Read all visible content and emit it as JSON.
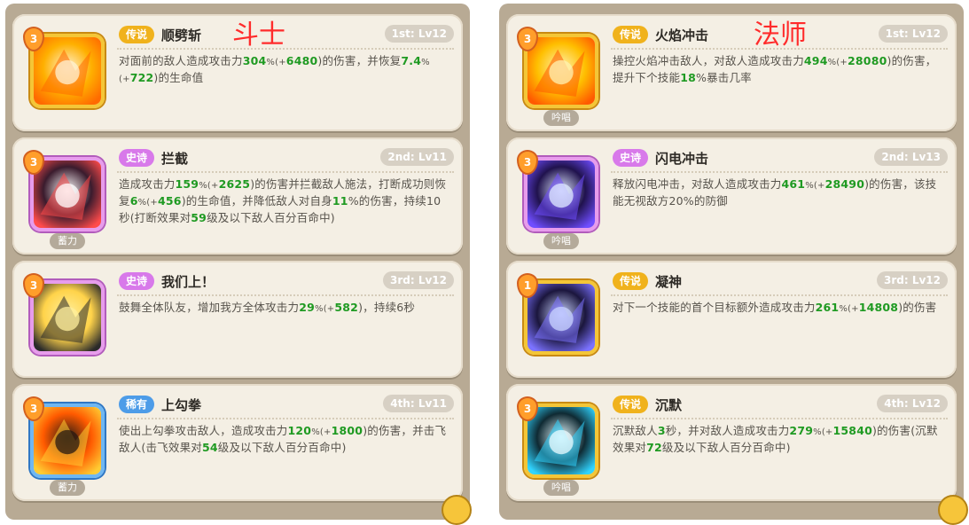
{
  "left": {
    "class_label": "斗士",
    "skills": [
      {
        "rarity": "传说",
        "name": "顺劈斩",
        "level": "1st: Lv12",
        "gem": "3",
        "tag": "",
        "desc_parts": [
          [
            "对面前的敌人造成攻击力",
            ""
          ],
          [
            "304",
            "g"
          ],
          [
            "%(+",
            "s"
          ],
          [
            "6480",
            "g"
          ],
          [
            ")的伤害，并恢复",
            ""
          ],
          [
            "7.4",
            "g"
          ],
          [
            "%(+",
            "s"
          ],
          [
            "722",
            "g"
          ],
          [
            ")的生命值",
            ""
          ]
        ]
      },
      {
        "rarity": "史诗",
        "name": "拦截",
        "level": "2nd: Lv11",
        "gem": "3",
        "tag": "蓄力",
        "desc_parts": [
          [
            "造成攻击力",
            ""
          ],
          [
            "159",
            "g"
          ],
          [
            "%(+",
            "s"
          ],
          [
            "2625",
            "g"
          ],
          [
            ")的伤害并拦截敌人施法，打断成功则恢复",
            ""
          ],
          [
            "6",
            "g"
          ],
          [
            "%(+",
            "s"
          ],
          [
            "456",
            "g"
          ],
          [
            ")的生命值，并降低敌人对自身",
            ""
          ],
          [
            "11",
            "g"
          ],
          [
            "%的伤害，持续10秒(打断效果对",
            ""
          ],
          [
            "59",
            "g"
          ],
          [
            "级及以下敌人百分百命中)",
            ""
          ]
        ]
      },
      {
        "rarity": "史诗",
        "name": "我们上！",
        "level": "3rd: Lv12",
        "gem": "3",
        "tag": "",
        "desc_parts": [
          [
            "鼓舞全体队友，增加我方全体攻击力",
            ""
          ],
          [
            "29",
            "g"
          ],
          [
            "%(+",
            "s"
          ],
          [
            "582",
            "g"
          ],
          [
            ")，持续6秒",
            ""
          ]
        ]
      },
      {
        "rarity": "稀有",
        "name": "上勾拳",
        "level": "4th: Lv11",
        "gem": "3",
        "tag": "蓄力",
        "desc_parts": [
          [
            "使出上勾拳攻击敌人，造成攻击力",
            ""
          ],
          [
            "120",
            "g"
          ],
          [
            "%(+",
            "s"
          ],
          [
            "1800",
            "g"
          ],
          [
            ")的伤害，并击飞敌人(击飞效果对",
            ""
          ],
          [
            "54",
            "g"
          ],
          [
            "级及以下敌人百分百命中)",
            ""
          ]
        ]
      }
    ]
  },
  "right": {
    "class_label": "法师",
    "skills": [
      {
        "rarity": "传说",
        "name": "火焰冲击",
        "level": "1st: Lv12",
        "gem": "3",
        "tag": "吟唱",
        "desc_parts": [
          [
            "操控火焰冲击敌人，对敌人造成攻击力",
            ""
          ],
          [
            "494",
            "g"
          ],
          [
            "%(+",
            "s"
          ],
          [
            "28080",
            "g"
          ],
          [
            ")的伤害，提升下个技能",
            ""
          ],
          [
            "18",
            "g"
          ],
          [
            "%暴击几率",
            ""
          ]
        ]
      },
      {
        "rarity": "史诗",
        "name": "闪电冲击",
        "level": "2nd: Lv13",
        "gem": "3",
        "tag": "吟唱",
        "desc_parts": [
          [
            "释放闪电冲击，对敌人造成攻击力",
            ""
          ],
          [
            "461",
            "g"
          ],
          [
            "%(+",
            "s"
          ],
          [
            "28490",
            "g"
          ],
          [
            ")的伤害，该技能无视敌方20%的防御",
            ""
          ]
        ]
      },
      {
        "rarity": "传说",
        "name": "凝神",
        "level": "3rd: Lv12",
        "gem": "1",
        "tag": "",
        "desc_parts": [
          [
            "对下一个技能的首个目标额外造成攻击力",
            ""
          ],
          [
            "261",
            "g"
          ],
          [
            "%(+",
            "s"
          ],
          [
            "14808",
            "g"
          ],
          [
            ")的伤害",
            ""
          ]
        ]
      },
      {
        "rarity": "传说",
        "name": "沉默",
        "level": "4th: Lv12",
        "gem": "3",
        "tag": "吟唱",
        "desc_parts": [
          [
            "沉默敌人",
            ""
          ],
          [
            "3",
            "g"
          ],
          [
            "秒，并对敌人造成攻击力",
            ""
          ],
          [
            "279",
            "g"
          ],
          [
            "%(+",
            "s"
          ],
          [
            "15840",
            "g"
          ],
          [
            ")的伤害(沉默效果对",
            ""
          ],
          [
            "72",
            "g"
          ],
          [
            "级及以下敌人百分百命中)",
            ""
          ]
        ]
      }
    ]
  },
  "colors": {
    "legend": "#f0b21c",
    "epic": "#d879ea",
    "rare": "#4d9ce8",
    "highlight_green": "#1f9a22",
    "class_label_red": "#ff2b2b"
  },
  "icons": {
    "left": [
      "cleave-axe-icon",
      "intercept-shield-icon",
      "rally-cheer-icon",
      "uppercut-fist-icon"
    ],
    "right": [
      "flame-burst-icon",
      "lightning-strike-icon",
      "focus-eye-icon",
      "silence-cube-icon"
    ]
  }
}
